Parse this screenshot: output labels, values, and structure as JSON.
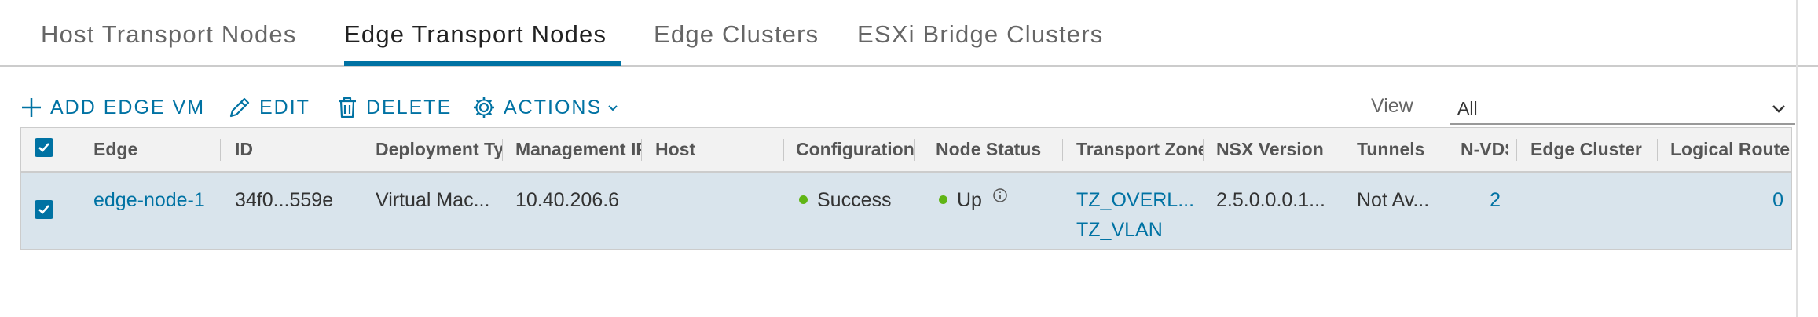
{
  "tabs": [
    {
      "label": "Host Transport Nodes"
    },
    {
      "label": "Edge Transport Nodes"
    },
    {
      "label": "Edge Clusters"
    },
    {
      "label": "ESXi Bridge Clusters"
    }
  ],
  "active_tab_index": 1,
  "toolbar": {
    "add_label": "ADD EDGE VM",
    "edit_label": "EDIT",
    "delete_label": "DELETE",
    "actions_label": "ACTIONS"
  },
  "view": {
    "label": "View",
    "selected": "All"
  },
  "grid": {
    "columns": [
      "Edge",
      "ID",
      "Deployment Ty",
      "Management IP",
      "Host",
      "Configuration S",
      "Node Status",
      "Transport Zone",
      "NSX Version",
      "Tunnels",
      "N-VDS",
      "Edge Cluster",
      "Logical Routers"
    ],
    "rows": [
      {
        "selected": true,
        "edge": "edge-node-1",
        "id": "34f0...559e",
        "deployment_type": "Virtual Mac...",
        "management_ip": "10.40.206.6",
        "host": "",
        "configuration_state": "Success",
        "node_status": "Up",
        "transport_zones": [
          "TZ_OVERL...",
          "TZ_VLAN"
        ],
        "nsx_version": "2.5.0.0.0.1...",
        "tunnels": "Not Av...",
        "nvds": "2",
        "edge_cluster": "",
        "logical_routers": "0"
      }
    ]
  },
  "colors": {
    "accent": "#0072a3",
    "status_green": "#60b515",
    "row_selected": "#d9e4ec"
  },
  "icons": {
    "add": "plus-icon",
    "edit": "pencil-icon",
    "delete": "trash-icon",
    "actions": "gear-icon",
    "info": "info-icon",
    "dropdown": "chevron-down-icon"
  }
}
